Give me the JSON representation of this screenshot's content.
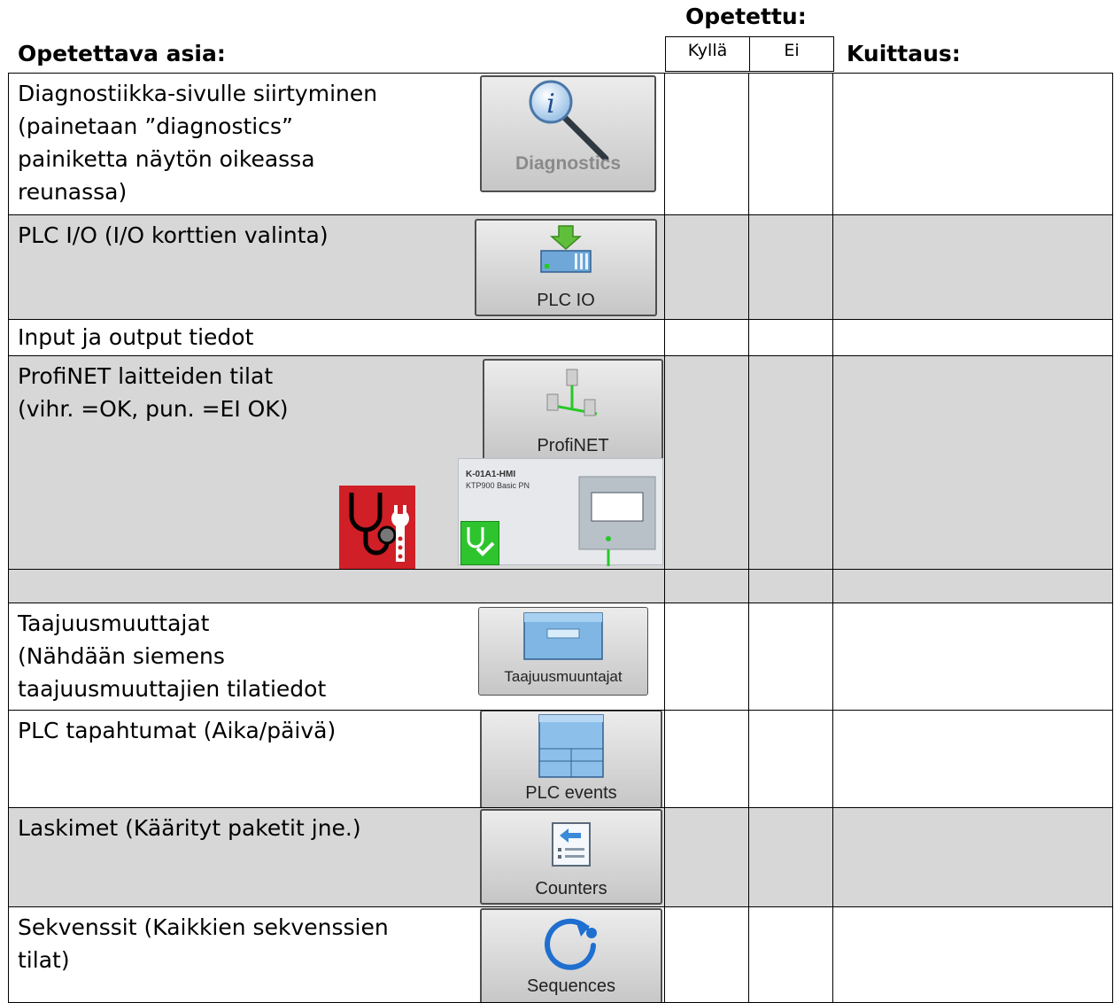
{
  "header": {
    "opetettu": "Opetettu:",
    "asia": "Opetettava asia:",
    "kyllä": "Kyllä",
    "ei": "Ei",
    "kuittaus": "Kuittaus:"
  },
  "rows": [
    {
      "text": "Diagnostiikka-sivulle siirtyminen\n(painetaan ”diagnostics”\npainiketta näytön oikeassa\nreunassa)",
      "button": "Diagnostics",
      "icon": "magnifier-info-icon"
    },
    {
      "text": "PLC I/O (I/O korttien valinta)",
      "button": "PLC IO",
      "icon": "io-module-icon"
    },
    {
      "text": "Input ja output tiedot"
    },
    {
      "text": "ProfiNET laitteiden tilat\n(vihr. =OK, pun. =EI OK)",
      "button": "ProfiNET",
      "icon": "network-icon",
      "device": {
        "name": "K-01A1-HMI",
        "type": "KTP900 Basic PN"
      }
    },
    {
      "text": ""
    },
    {
      "text": "Taajuusmuuttajat\n(Nähdään siemens\ntaajuusmuuttajien tilatiedot",
      "button": "Taajuusmuuntajat",
      "icon": "drive-icon"
    },
    {
      "text": "PLC tapahtumat (Aika/päivä)",
      "button": "PLC events",
      "icon": "plc-icon"
    },
    {
      "text": "Laskimet (Käärityt paketit jne.)",
      "button": "Counters",
      "icon": "counter-list-icon"
    },
    {
      "text": "Sekvenssit (Kaikkien sekvenssien\ntilat)",
      "button": "Sequences",
      "icon": "sequence-cycle-icon"
    }
  ],
  "colors": {
    "row_gray": "#d7d7d7",
    "diag_red": "#d01f26",
    "ok_green": "#2ec42e"
  }
}
